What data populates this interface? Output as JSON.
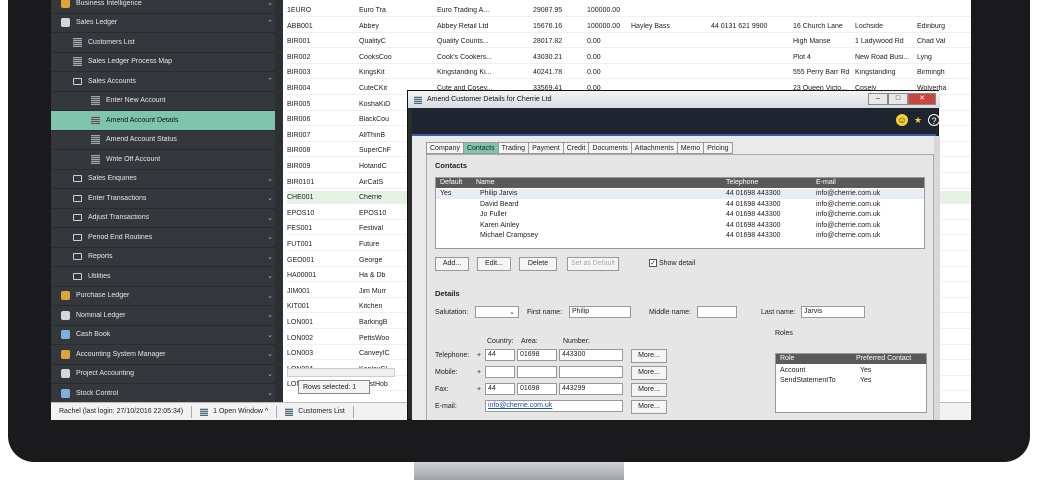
{
  "sidebar": {
    "items": [
      {
        "label": "Business Intelligence",
        "icon": "business-intelligence-icon",
        "chev": "⌄",
        "active": false,
        "indent": 0
      },
      {
        "label": "Sales Ledger",
        "icon": "sales-ledger-icon",
        "chev": "⌃",
        "active": false,
        "indent": 0
      },
      {
        "label": "Customers List",
        "icon": "grid-icon",
        "chev": "",
        "active": false,
        "indent": 1
      },
      {
        "label": "Sales Ledger Process Map",
        "icon": "process-map-icon",
        "chev": "",
        "active": false,
        "indent": 1
      },
      {
        "label": "Sales Accounts",
        "icon": "folder-icon",
        "chev": "⌃",
        "active": false,
        "indent": 1
      },
      {
        "label": "Enter New Account",
        "icon": "grid-icon",
        "chev": "",
        "active": false,
        "indent": 2
      },
      {
        "label": "Amend Account Details",
        "icon": "grid-icon",
        "chev": "",
        "active": true,
        "indent": 2
      },
      {
        "label": "Amend Account Status",
        "icon": "grid-icon",
        "chev": "",
        "active": false,
        "indent": 2
      },
      {
        "label": "Write Off Account",
        "icon": "grid-icon",
        "chev": "",
        "active": false,
        "indent": 2
      },
      {
        "label": "Sales Enquiries",
        "icon": "folder-icon",
        "chev": "⌄",
        "active": false,
        "indent": 1
      },
      {
        "label": "Enter Transactions",
        "icon": "folder-icon",
        "chev": "⌄",
        "active": false,
        "indent": 1
      },
      {
        "label": "Adjust Transactions",
        "icon": "folder-icon",
        "chev": "⌄",
        "active": false,
        "indent": 1
      },
      {
        "label": "Period End Routines",
        "icon": "folder-icon",
        "chev": "⌄",
        "active": false,
        "indent": 1
      },
      {
        "label": "Reports",
        "icon": "folder-icon",
        "chev": "⌄",
        "active": false,
        "indent": 1
      },
      {
        "label": "Utilities",
        "icon": "folder-icon",
        "chev": "⌄",
        "active": false,
        "indent": 1
      },
      {
        "label": "Purchase Ledger",
        "icon": "purchase-ledger-icon",
        "chev": "⌄",
        "active": false,
        "indent": 0
      },
      {
        "label": "Nominal Ledger",
        "icon": "nominal-ledger-icon",
        "chev": "⌄",
        "active": false,
        "indent": 0
      },
      {
        "label": "Cash Book",
        "icon": "cash-book-icon",
        "chev": "⌄",
        "active": false,
        "indent": 0
      },
      {
        "label": "Accounting System Manager",
        "icon": "system-manager-icon",
        "chev": "⌄",
        "active": false,
        "indent": 0
      },
      {
        "label": "Project Accounting",
        "icon": "project-accounting-icon",
        "chev": "⌄",
        "active": false,
        "indent": 0
      },
      {
        "label": "Stock Control",
        "icon": "stock-control-icon",
        "chev": "⌄",
        "active": false,
        "indent": 0
      }
    ]
  },
  "grid": {
    "rows": [
      [
        "1EURO",
        "Euro Tra",
        "Euro Trading A...",
        "29087.95",
        "100000.00",
        "",
        "",
        "",
        "",
        ""
      ],
      [
        "ABB001",
        "Abbey",
        "Abbey Retail Ltd",
        "15676.16",
        "100000.00",
        "Hayley Bass",
        "44 0131 621 9900",
        "16 Church Lane",
        "Lochside",
        "Edinburg"
      ],
      [
        "BIR001",
        "QualityC",
        "Quality Counts...",
        "28017.82",
        "0.00",
        "",
        "",
        "High Manse",
        "1 Ladywood Rd",
        "Chad Val"
      ],
      [
        "BIR002",
        "CooksCoo",
        "Cook's Cookers...",
        "43030.21",
        "0.00",
        "",
        "",
        "Plot 4",
        "New Road Busi...",
        "Lyng"
      ],
      [
        "BIR003",
        "KingsKit",
        "Kingstanding Ki...",
        "40241.78",
        "0.00",
        "",
        "",
        "555 Perry Barr Rd",
        "Kingstanding",
        "Birmingh"
      ],
      [
        "BIR004",
        "CuteCKit",
        "Cute and Cosey...",
        "33569.41",
        "0.00",
        "",
        "",
        "23 Queen Victo...",
        "Cosely",
        "Wolverha"
      ],
      [
        "BIR005",
        "KoshaKiD",
        "",
        "",
        "",
        "",
        "",
        "",
        "",
        "minghi"
      ],
      [
        "BIR006",
        "BlackCou",
        "",
        "",
        "",
        "",
        "",
        "",
        "",
        "st Mid"
      ],
      [
        "BIR007",
        "AllThinB",
        "",
        "",
        "",
        "",
        "",
        "",
        "",
        "st Mid"
      ],
      [
        "BIR008",
        "SuperChF",
        "",
        "",
        "",
        "",
        "",
        "",
        "",
        "minghi"
      ],
      [
        "BIR009",
        "HotandC",
        "",
        "",
        "",
        "",
        "",
        "",
        "",
        "dermi"
      ],
      [
        "BIR0101",
        "AirCatS",
        "",
        "",
        "",
        "",
        "",
        "",
        "",
        "rston"
      ],
      [
        "CHE001",
        "Cherrie",
        "",
        "",
        "",
        "",
        "",
        "",
        "",
        "arkshi"
      ],
      [
        "EPOS10",
        "EPOS10",
        "",
        "",
        "",
        "",
        "",
        "",
        "",
        ""
      ],
      [
        "FES001",
        "Festival",
        "",
        "",
        "",
        "",
        "",
        "",
        "",
        "ndon"
      ],
      [
        "FUT001",
        "Future",
        "",
        "",
        "",
        "",
        "",
        "",
        "",
        "cles"
      ],
      [
        "GEO001",
        "George",
        "",
        "",
        "",
        "",
        "",
        "",
        "",
        "lock"
      ],
      [
        "HA00001",
        "Ha & Db",
        "",
        "",
        "",
        "",
        "",
        "",
        "",
        "ingsto"
      ],
      [
        "JIM001",
        "Jim Murr",
        "",
        "",
        "",
        "",
        "",
        "",
        "",
        "wich"
      ],
      [
        "KIT001",
        "Kitchen",
        "",
        "",
        "",
        "",
        "",
        "",
        "",
        "rdiff"
      ],
      [
        "LON001",
        "BarkingB",
        "",
        "",
        "",
        "",
        "",
        "",
        "",
        "rking"
      ],
      [
        "LON002",
        "PettsWoo",
        "",
        "",
        "",
        "",
        "",
        "",
        "",
        "mboro"
      ],
      [
        "LON003",
        "CanveyIC",
        "",
        "",
        "",
        "",
        "",
        "",
        "",
        "nvey I"
      ],
      [
        "LON004",
        "KenleyCl",
        "",
        "",
        "",
        "",
        "",
        "",
        "",
        "ndon"
      ],
      [
        "LON005",
        "HalstHob",
        "",
        "",
        "",
        "",
        "",
        "",
        "",
        "venoal"
      ]
    ],
    "selected_index": 12,
    "rows_selected": "Rows selected: 1"
  },
  "status": {
    "user": "Rachel (last login: 27/10/2016 22:05:34)",
    "windows": "1 Open Window ^",
    "tab": "Customers List"
  },
  "dialog": {
    "title": "Amend Customer Details for Cherrie Ltd",
    "tabs": [
      "Company",
      "Contacts",
      "Trading",
      "Payment",
      "Credit",
      "Documents",
      "Attachments",
      "Memo",
      "Pricing"
    ],
    "active_tab": 1,
    "contacts_heading": "Contacts",
    "contacts_columns": [
      "Default",
      "Name",
      "Telephone",
      "E-mail"
    ],
    "contacts": [
      {
        "default": "Yes",
        "name": "Philip Jarvis",
        "tel": "44 01698 443300",
        "email": "info@cherrie.com.uk"
      },
      {
        "default": "",
        "name": "David Beard",
        "tel": "44 01698 443300",
        "email": "info@cherrie.com.uk"
      },
      {
        "default": "",
        "name": "Jo Fuller",
        "tel": "44 01698 443300",
        "email": "info@cherrie.com.uk"
      },
      {
        "default": "",
        "name": "Karen Ainley",
        "tel": "44 01698 443300",
        "email": "info@cherrie.com.uk"
      },
      {
        "default": "",
        "name": "Michael Crampsey",
        "tel": "44 01698 443300",
        "email": "info@cherrie.com.uk"
      }
    ],
    "buttons": {
      "add": "Add...",
      "edit": "Edit...",
      "delete": "Delete",
      "set_default": "Set as Default",
      "show_detail": "Show detail"
    },
    "details_heading": "Details",
    "salutation_label": "Salutation:",
    "first_name_label": "First name:",
    "first_name": "Philip",
    "middle_name_label": "Middle name:",
    "middle_name": "",
    "last_name_label": "Last name:",
    "last_name": "Jarvis",
    "col_country": "Country:",
    "col_area": "Area:",
    "col_number": "Number:",
    "phone_rows": [
      {
        "label": "Telephone:",
        "plus": "+",
        "country": "44",
        "area": "01698",
        "number": "443300",
        "more": "More..."
      },
      {
        "label": "Mobile:",
        "plus": "+",
        "country": "",
        "area": "",
        "number": "",
        "more": "More..."
      },
      {
        "label": "Fax:",
        "plus": "+",
        "country": "44",
        "area": "01698",
        "number": "443299",
        "more": "More..."
      }
    ],
    "email_label": "E-mail:",
    "email": "info@cherrie.com.uk",
    "email_more": "More...",
    "roles_heading": "Roles",
    "roles_columns": [
      "Role",
      "Preferred Contact"
    ],
    "roles": [
      {
        "role": "Account",
        "pref": "Yes"
      },
      {
        "role": "SendStatementTo",
        "pref": "Yes"
      }
    ]
  },
  "colors": {
    "accent": "#7fc4ad",
    "sidebar": "#34383c",
    "toolbar_line": "#3b5fa3"
  }
}
